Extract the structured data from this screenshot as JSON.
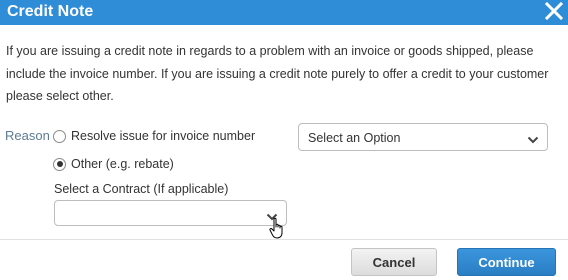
{
  "dialog": {
    "title": "Credit Note",
    "close_icon": "close-icon",
    "description": "If you are issuing a credit note in regards to a problem with an invoice or goods shipped, please include the invoice number. If you are issuing a credit note purely to offer a credit to your customer please select other."
  },
  "form": {
    "reason_label": "Reason",
    "options": [
      {
        "label": "Resolve issue for invoice number",
        "checked": false
      },
      {
        "label": "Other (e.g. rebate)",
        "checked": true
      }
    ],
    "invoice_select_value": "Select an Option",
    "contract_label": "Select a Contract (If applicable)",
    "contract_select_value": ""
  },
  "footer": {
    "cancel_label": "Cancel",
    "continue_label": "Continue"
  },
  "colors": {
    "titlebar": "#2f8dd7",
    "primary_button": "#2f8dd7",
    "reason_label": "#5e7c96"
  }
}
